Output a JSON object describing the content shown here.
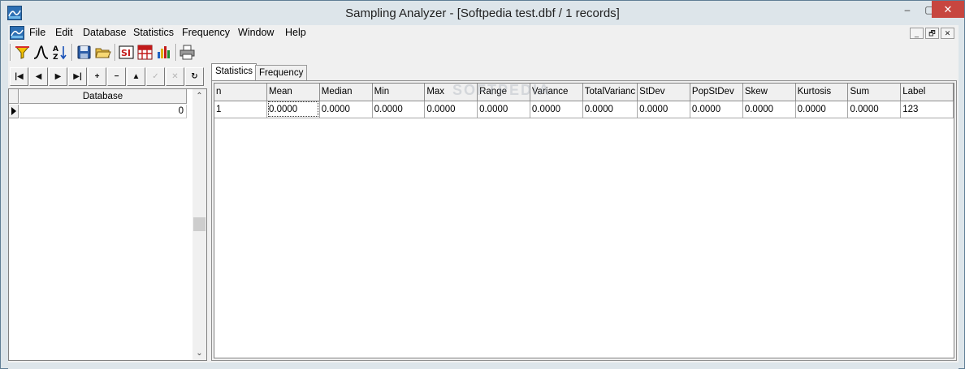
{
  "window": {
    "title": "Sampling Analyzer - [Softpedia test.dbf / 1 records]",
    "controls": {
      "minimize": "‒",
      "maximize": "▢",
      "close": "✕"
    }
  },
  "menu": {
    "items": [
      {
        "id": "file",
        "label": "File"
      },
      {
        "id": "edit",
        "label": "Edit"
      },
      {
        "id": "database",
        "label": "Database"
      },
      {
        "id": "statistics",
        "label": "Statistics"
      },
      {
        "id": "frequency",
        "label": "Frequency"
      },
      {
        "id": "window",
        "label": "Window"
      },
      {
        "id": "help",
        "label": "Help"
      }
    ],
    "mdi_controls": {
      "minimize": "_",
      "restore": "🗗",
      "close": "✕"
    }
  },
  "toolbar": {
    "buttons": [
      {
        "id": "filter",
        "icon": "filter-icon"
      },
      {
        "id": "curve",
        "icon": "normal-curve-icon"
      },
      {
        "id": "sort",
        "icon": "sort-az-icon"
      },
      {
        "id": "save",
        "icon": "save-icon"
      },
      {
        "id": "open",
        "icon": "open-folder-icon"
      },
      {
        "id": "statistics",
        "icon": "statistics-report-icon"
      },
      {
        "id": "table",
        "icon": "table-icon"
      },
      {
        "id": "chart",
        "icon": "bar-chart-icon"
      },
      {
        "id": "print",
        "icon": "printer-icon"
      }
    ]
  },
  "navigator": {
    "buttons": [
      {
        "id": "first",
        "glyph": "|◀",
        "icon": "first-record-icon",
        "enabled": true
      },
      {
        "id": "prior",
        "glyph": "◀",
        "icon": "prior-record-icon",
        "enabled": true
      },
      {
        "id": "next",
        "glyph": "▶",
        "icon": "next-record-icon",
        "enabled": true
      },
      {
        "id": "last",
        "glyph": "▶|",
        "icon": "last-record-icon",
        "enabled": true
      },
      {
        "id": "insert",
        "glyph": "+",
        "icon": "insert-record-icon",
        "enabled": true
      },
      {
        "id": "delete",
        "glyph": "−",
        "icon": "delete-record-icon",
        "enabled": true
      },
      {
        "id": "edit",
        "glyph": "▲",
        "icon": "edit-record-icon",
        "enabled": true
      },
      {
        "id": "post",
        "glyph": "✓",
        "icon": "post-record-icon",
        "enabled": false
      },
      {
        "id": "cancel",
        "glyph": "✕",
        "icon": "cancel-record-icon",
        "enabled": false
      },
      {
        "id": "refresh",
        "glyph": "↻",
        "icon": "refresh-icon",
        "enabled": true
      }
    ]
  },
  "database_grid": {
    "header": "Database",
    "rows": [
      {
        "value": "0"
      }
    ]
  },
  "tabs": [
    {
      "id": "statistics",
      "label": "Statistics",
      "active": true
    },
    {
      "id": "frequency",
      "label": "Frequency",
      "active": false
    }
  ],
  "stats_grid": {
    "columns": [
      "n",
      "Mean",
      "Median",
      "Min",
      "Max",
      "Range",
      "Variance",
      "TotalVarianc",
      "StDev",
      "PopStDev",
      "Skew",
      "Kurtosis",
      "Sum",
      "Label"
    ],
    "rows": [
      [
        "1",
        "0.0000",
        "0.0000",
        "0.0000",
        "0.0000",
        "0.0000",
        "0.0000",
        "0.0000",
        "0.0000",
        "0.0000",
        "0.0000",
        "0.0000",
        "0.0000",
        "123"
      ]
    ]
  },
  "watermark": "SOFTPEDIA"
}
